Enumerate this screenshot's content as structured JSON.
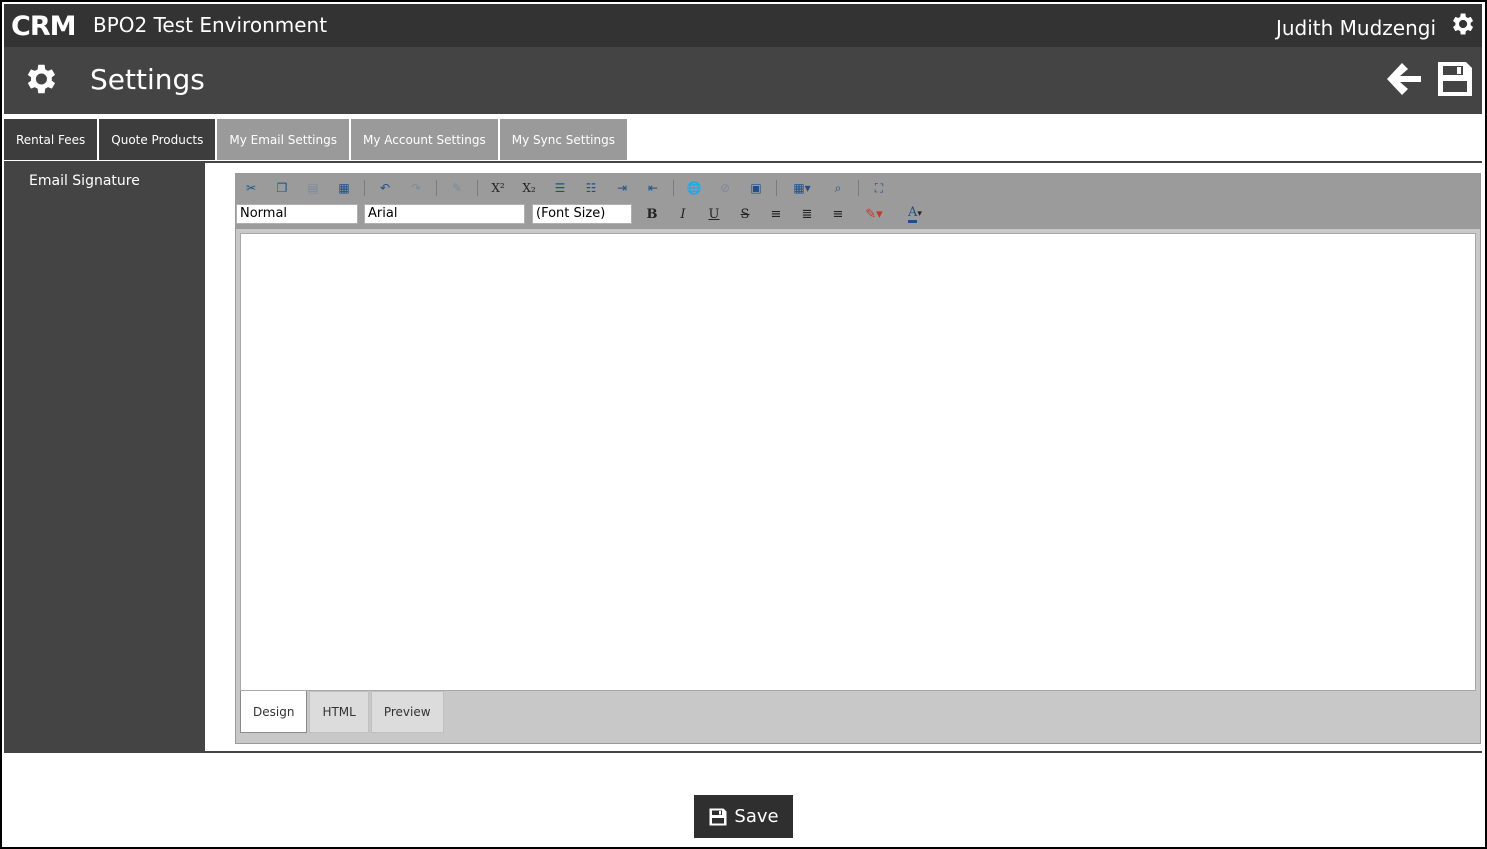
{
  "app": {
    "logo_text": "CRM",
    "title": "BPO2 Test Environment",
    "user_name": "Judith Mudzengi"
  },
  "header": {
    "title": "Settings"
  },
  "tabs": [
    {
      "label": "Rental Fees",
      "state": "dark"
    },
    {
      "label": "Quote Products",
      "state": "dark"
    },
    {
      "label": "My Email Settings",
      "state": "active"
    },
    {
      "label": "My Account Settings",
      "state": "light"
    },
    {
      "label": "My Sync Settings",
      "state": "light"
    }
  ],
  "sidebar": {
    "items": [
      {
        "label": "Email Signature"
      }
    ]
  },
  "editor": {
    "paragraph_format": "Normal",
    "font_name": "Arial",
    "font_size": "(Font Size)",
    "format_buttons": {
      "bold": "B",
      "italic": "I",
      "underline": "U",
      "strike": "S"
    },
    "font_color_label": "A",
    "superscript_label": "X²",
    "subscript_label": "X₂",
    "mode_tabs": [
      {
        "label": "Design",
        "active": true
      },
      {
        "label": "HTML",
        "active": false
      },
      {
        "label": "Preview",
        "active": false
      }
    ]
  },
  "footer": {
    "save_label": "Save"
  },
  "colors": {
    "topbar": "#333333",
    "headerbar": "#444444",
    "tab_inactive": "#9a9a9a",
    "accent_blue": "#1f4f8a"
  }
}
